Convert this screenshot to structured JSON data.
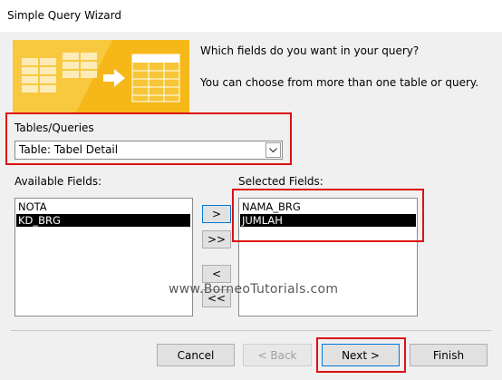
{
  "window": {
    "title": "Simple Query Wizard"
  },
  "header": {
    "question": "Which fields do you want in your query?",
    "hint": "You can choose from more than one table or query."
  },
  "tables_queries": {
    "label": "Tables/Queries",
    "selected": "Table: Tabel Detail"
  },
  "available_fields": {
    "label": "Available Fields:",
    "items": [
      "NOTA",
      "KD_BRG"
    ],
    "selected_index": 1
  },
  "selected_fields": {
    "label": "Selected Fields:",
    "items": [
      "NAMA_BRG",
      "JUMLAH"
    ],
    "selected_index": 1
  },
  "move_buttons": {
    "add_one": ">",
    "add_all": ">>",
    "remove_one": "<",
    "remove_all": "<<"
  },
  "footer": {
    "cancel": "Cancel",
    "back": "< Back",
    "next": "Next >",
    "finish": "Finish"
  },
  "watermark": "www.BorneoTutorials.com",
  "colors": {
    "highlight_border": "#d11111",
    "graphic_background": "#f6b818",
    "selection_background": "#000000",
    "dialog_background": "#f0f0f0"
  },
  "icons": {
    "combo_arrow": "chevron-down-icon",
    "banner": "wizard-graphic"
  }
}
